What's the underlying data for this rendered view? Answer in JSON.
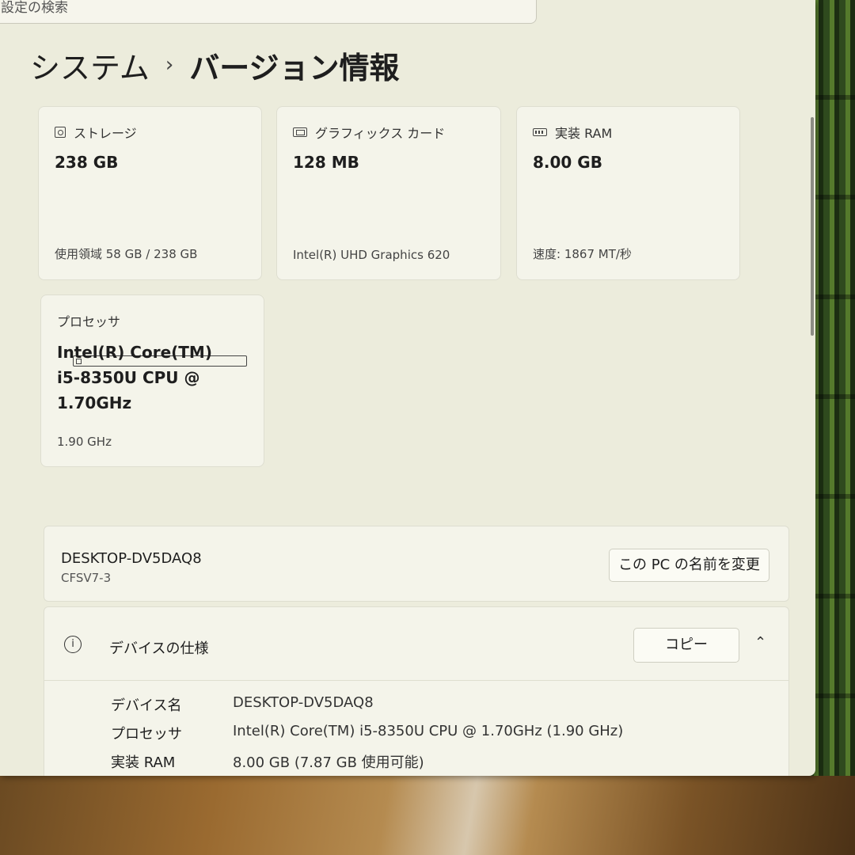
{
  "search": {
    "placeholder": "設定の検索"
  },
  "breadcrumb": {
    "parent": "システム",
    "separator": "›",
    "current": "バージョン情報"
  },
  "tiles": {
    "storage": {
      "label": "ストレージ",
      "value": "238 GB",
      "sub": "使用領域 58 GB / 238 GB",
      "icon": "storage-icon"
    },
    "graphics": {
      "label": "グラフィックス カード",
      "value": "128 MB",
      "sub": "Intel(R) UHD Graphics 620",
      "icon": "graphics-card-icon"
    },
    "ram": {
      "label": "実装 RAM",
      "value": "8.00 GB",
      "sub": "速度: 1867 MT/秒",
      "icon": "ram-icon"
    },
    "processor": {
      "label": "プロセッサ",
      "value": "Intel(R) Core(TM) i5-8350U CPU @ 1.70GHz",
      "sub": "1.90 GHz",
      "icon": "processor-icon"
    }
  },
  "pc": {
    "name": "DESKTOP-DV5DAQ8",
    "model": "CFSV7-3",
    "rename_button": "この PC の名前を変更"
  },
  "device_spec": {
    "title": "デバイスの仕様",
    "copy_button": "コピー",
    "rows": [
      {
        "label": "デバイス名",
        "value": "DESKTOP-DV5DAQ8"
      },
      {
        "label": "プロセッサ",
        "value": "Intel(R) Core(TM) i5-8350U CPU @ 1.70GHz (1.90 GHz)"
      },
      {
        "label": "実装 RAM",
        "value": "8.00 GB (7.87 GB 使用可能)"
      }
    ]
  }
}
